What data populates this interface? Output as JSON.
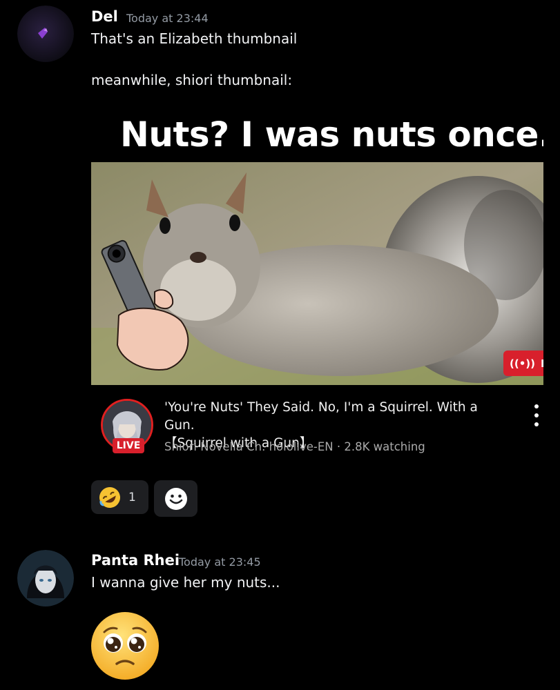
{
  "messages": [
    {
      "author": "Del",
      "timestamp": "Today at 23:44",
      "lines": [
        "That's an Elizabeth thumbnail",
        "meanwhile, shiori thumbnail:"
      ]
    },
    {
      "author": "Panta Rhei",
      "timestamp": "Today at 23:45",
      "lines": [
        "I wanna give her my nuts..."
      ]
    }
  ],
  "embed": {
    "thumbnail_title": "Nuts? I was nuts once.",
    "live_indicator": "LI",
    "video_title_line1": "'You're Nuts' They Said. No, I'm a Squirrel. With a Gun.",
    "video_title_line2": "【Squirrel with a Gun】",
    "channel_meta": "Shiori Novella Ch. hololive-EN · 2.8K watching",
    "live_badge": "LIVE"
  },
  "reactions": [
    {
      "emoji": "rolling-on-floor-laughing",
      "count": "1"
    }
  ],
  "emoji_message": "pleading-face",
  "colors": {
    "background": "#000000",
    "live_red": "#d8202c",
    "reaction_bg": "#1e1f22",
    "timestamp": "#949ba4"
  }
}
